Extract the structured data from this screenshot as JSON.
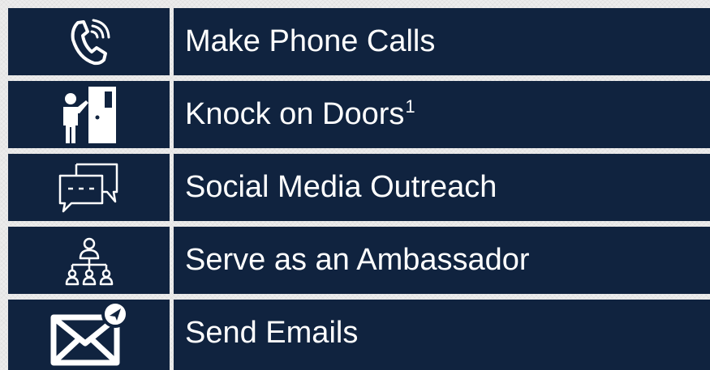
{
  "colors": {
    "cell_background": "#10233f",
    "text": "#ffffff",
    "grid": "#ececec"
  },
  "items": [
    {
      "label": "Make Phone Calls",
      "icon": "phone-ringing-icon"
    },
    {
      "label": "Knock on Doors",
      "superscript": "1",
      "icon": "person-knocking-door-icon"
    },
    {
      "label": "Social Media Outreach",
      "icon": "chat-bubbles-icon"
    },
    {
      "label": "Serve as an Ambassador",
      "icon": "org-hierarchy-icon"
    },
    {
      "label": "Send Emails",
      "icon": "email-send-icon"
    }
  ]
}
